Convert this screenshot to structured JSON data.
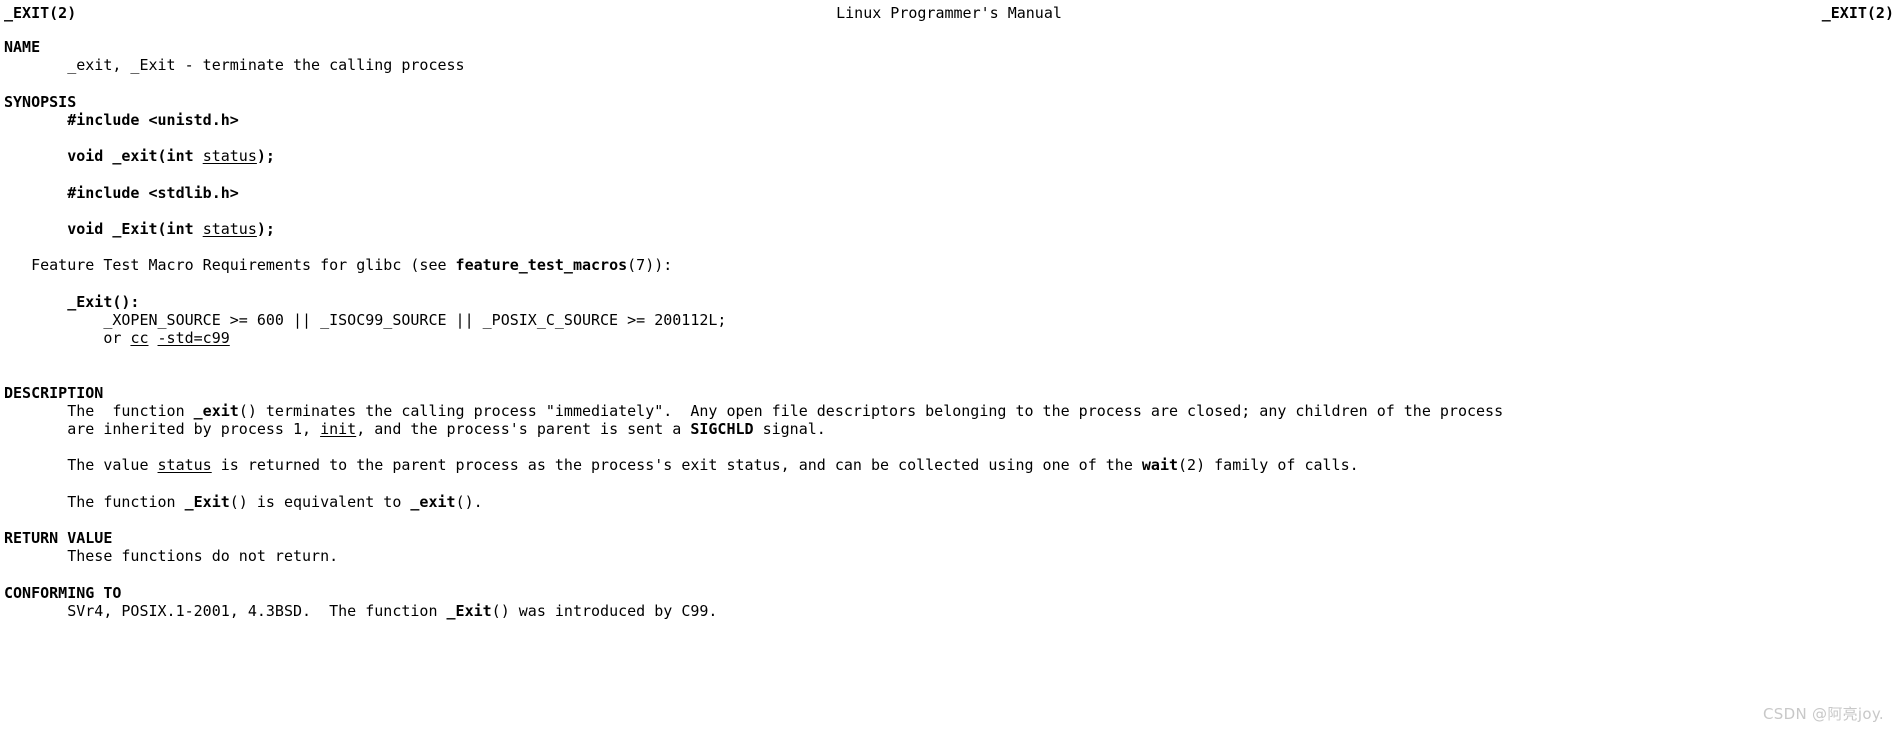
{
  "header": {
    "left_title": "_EXIT(2)",
    "center_title": "Linux Programmer's Manual",
    "right_title": "_EXIT(2)"
  },
  "sections": {
    "name": {
      "heading": "NAME",
      "body": "       _exit, _Exit - terminate the calling process"
    },
    "synopsis": {
      "heading": "SYNOPSIS",
      "include_unistd": "       #include <unistd.h>",
      "proto_exit_pre": "       void _exit(int ",
      "proto_exit_param": "status",
      "proto_exit_post": ");",
      "include_stdlib": "       #include <stdlib.h>",
      "proto_Exit_pre": "       void _Exit(int ",
      "proto_Exit_param": "status",
      "proto_Exit_post": ");",
      "ftm_pre": "   Feature Test Macro Requirements for glibc (see ",
      "ftm_bold": "feature_test_macros",
      "ftm_post": "(7)):",
      "ftm_label": "       _Exit():",
      "ftm_req_line": "           _XOPEN_SOURCE >= 600 || _ISOC99_SOURCE || _POSIX_C_SOURCE >= 200112L;",
      "ftm_or_pre": "           or ",
      "ftm_or_cc": "cc",
      "ftm_or_mid": " ",
      "ftm_or_std": "-std=c99"
    },
    "description": {
      "heading": "DESCRIPTION",
      "p1_a": "       The  function ",
      "p1_bold": "_exit",
      "p1_b": "() terminates the calling process \"immediately\".  Any open file descriptors belonging to the process are closed; any children of the process",
      "p1_line2_a": "       are inherited by process 1, ",
      "p1_line2_u": "init",
      "p1_line2_b": ", and the process's parent is sent a ",
      "p1_line2_bold": "SIGCHLD",
      "p1_line2_c": " signal.",
      "p2_a": "       The value ",
      "p2_u": "status",
      "p2_b": " is returned to the parent process as the process's exit status, and can be collected using one of the ",
      "p2_bold": "wait",
      "p2_c": "(2) family of calls.",
      "p3_a": "       The function ",
      "p3_bold": "_Exit",
      "p3_b": "() is equivalent to ",
      "p3_bold2": "_exit",
      "p3_c": "()."
    },
    "return_value": {
      "heading": "RETURN VALUE",
      "body": "       These functions do not return."
    },
    "conforming_to": {
      "heading": "CONFORMING TO",
      "body_a": "       SVr4, POSIX.1-2001, 4.3BSD.  The function ",
      "body_bold": "_Exit",
      "body_b": "() was introduced by C99."
    }
  },
  "watermark": {
    "text": "CSDN @阿亮joy."
  }
}
